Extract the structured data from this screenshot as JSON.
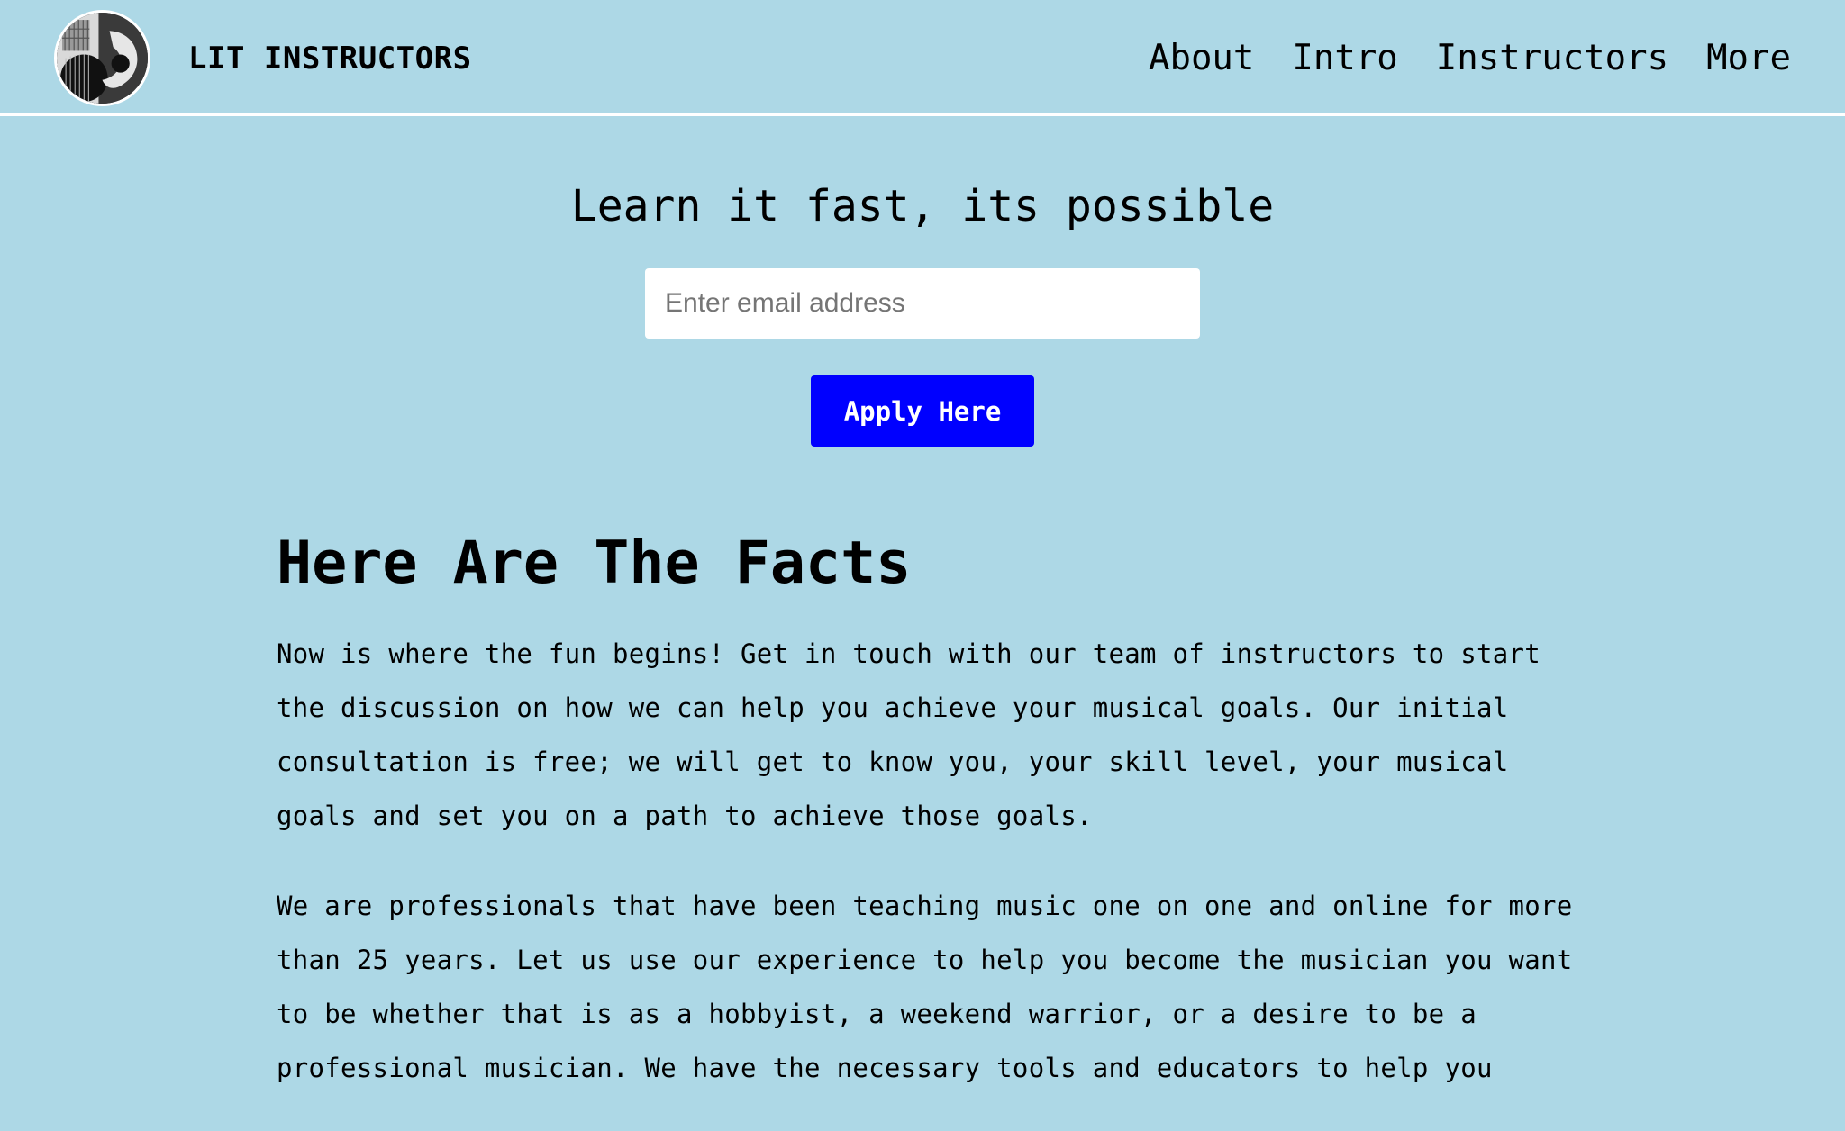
{
  "header": {
    "logo_icon": "guitar-logo-icon",
    "brand": "LIT INSTRUCTORS",
    "nav": [
      {
        "label": "About"
      },
      {
        "label": "Intro"
      },
      {
        "label": "Instructors"
      },
      {
        "label": "More"
      }
    ]
  },
  "hero": {
    "title": "Learn it fast, its possible",
    "email_placeholder": "Enter email address",
    "email_value": "",
    "apply_label": "Apply Here"
  },
  "facts": {
    "heading": "Here Are The Facts",
    "paragraphs": [
      "Now is where the fun begins! Get in touch with our team of instructors to start the discussion on how we can help you achieve your musical goals. Our initial consultation is free; we will get to know you, your skill level, your musical goals and set you on a path to achieve those goals.",
      "We are professionals that have been teaching music one on one and online for more than 25 years. Let us use our experience to help you become the musician you want to be whether that is as a hobbyist, a weekend warrior, or a desire to be a professional musician. We have the necessary tools and educators to help you"
    ]
  },
  "colors": {
    "background": "#add8e6",
    "button": "#0000ff",
    "divider": "#ffffff"
  }
}
